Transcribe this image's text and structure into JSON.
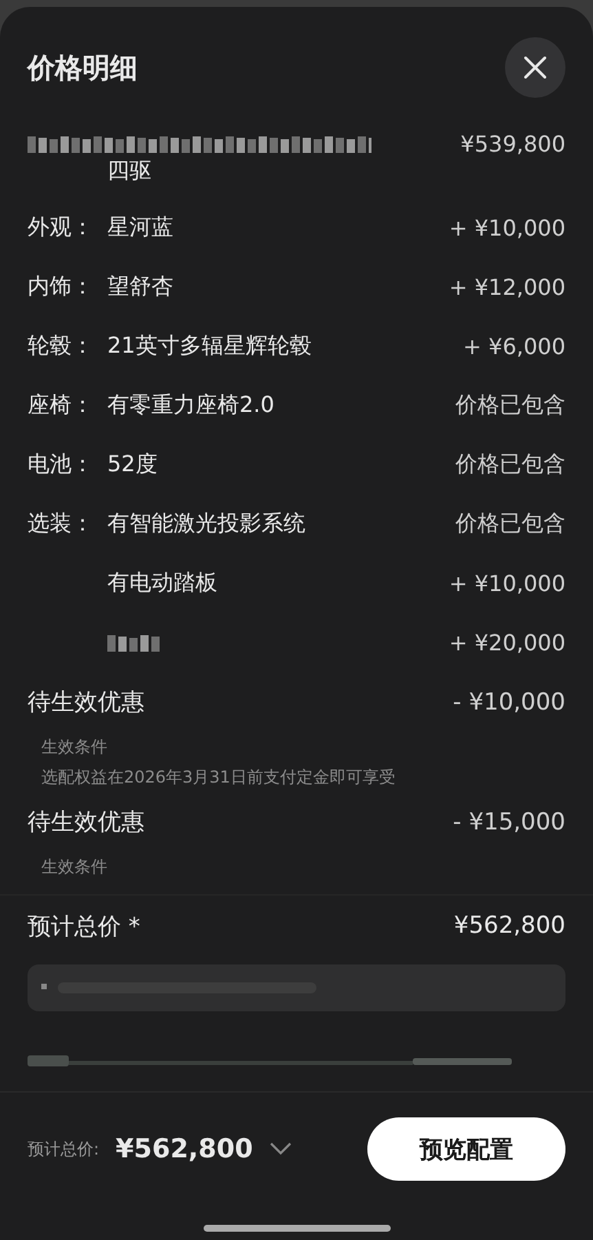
{
  "sheet": {
    "title": "价格明细"
  },
  "base": {
    "kind": "blurred",
    "price": "¥539,800",
    "detail": "四驱"
  },
  "items": [
    {
      "kind": "text",
      "label": "外观：",
      "value": "星河蓝",
      "price": "+ ¥10,000"
    },
    {
      "kind": "text",
      "label": "内饰：",
      "value": "望舒杏",
      "price": "+ ¥12,000"
    },
    {
      "kind": "text",
      "label": "轮毂：",
      "value": "21英寸多辐星辉轮毂",
      "price": "+ ¥6,000"
    },
    {
      "kind": "text",
      "label": "座椅：",
      "value": "有零重力座椅2.0",
      "price": "价格已包含"
    },
    {
      "kind": "text",
      "label": "电池：",
      "value": "52度",
      "price": "价格已包含"
    },
    {
      "kind": "text",
      "label": "选装：",
      "value": "有智能激光投影系统",
      "price": "价格已包含"
    },
    {
      "kind": "text",
      "value": "有电动踏板",
      "price": "+ ¥10,000"
    },
    {
      "kind": "blurred",
      "price": "+ ¥20,000"
    }
  ],
  "discounts": [
    {
      "title": "待生效优惠",
      "amount": "- ¥10,000",
      "condition_title": "生效条件",
      "condition": "选配权益在2026年3月31日前支付定金即可享受"
    },
    {
      "title": "待生效优惠",
      "amount": "- ¥15,000",
      "condition_title": "生效条件"
    }
  ],
  "total": {
    "label": "预计总价 *",
    "value": "¥562,800"
  },
  "footer": {
    "label": "预计总价:",
    "price": "¥562,800",
    "button": "预览配置"
  }
}
